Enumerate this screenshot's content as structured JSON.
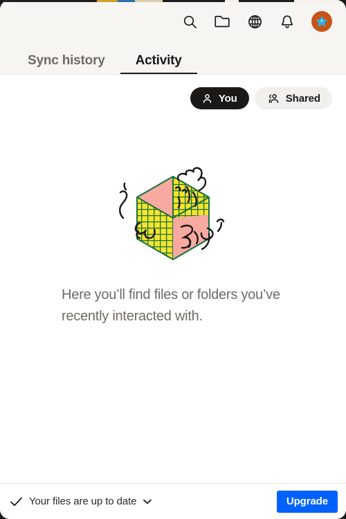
{
  "window": {
    "background": "#ffffff",
    "header_background": "#F7F5F2",
    "corner_radius_px": 14,
    "top_sliver_colors": [
      "#1c1c1c",
      "#c9a227",
      "#2f6fae",
      "#d9cfae",
      "#1c1c1c",
      "#f3efe8",
      "#1c1c1c",
      "#f5f1ea"
    ]
  },
  "header": {
    "icons": [
      {
        "name": "search-icon",
        "label": "Search"
      },
      {
        "name": "folder-icon",
        "label": "Files"
      },
      {
        "name": "globe-icon",
        "label": "Web"
      },
      {
        "name": "bell-icon",
        "label": "Notifications"
      }
    ],
    "avatar": {
      "name": "avatar",
      "label": "Account",
      "circle_color": "#C65416",
      "star_color": "#2BB3E8"
    }
  },
  "tabs": [
    {
      "label": "Sync history",
      "active": false
    },
    {
      "label": "Activity",
      "active": true
    }
  ],
  "filters": [
    {
      "label": "You",
      "icon": "person-icon",
      "selected": true
    },
    {
      "label": "Shared",
      "icon": "people-icon",
      "selected": false
    }
  ],
  "empty_state": {
    "illustration_name": "isometric-cube-doodle-illustration",
    "message": "Here you’ll find files or folders you’ve recently interacted with.",
    "illustration_colors": {
      "pink": "#F8A9A0",
      "yellow": "#F5E32B",
      "green": "#17713C",
      "ink": "#1A1918"
    }
  },
  "statusbar": {
    "check_icon": "check-icon",
    "status_text": "Your files are up to date",
    "chevron_icon": "chevron-down-icon",
    "upgrade_label": "Upgrade",
    "upgrade_color": "#0061FE"
  }
}
